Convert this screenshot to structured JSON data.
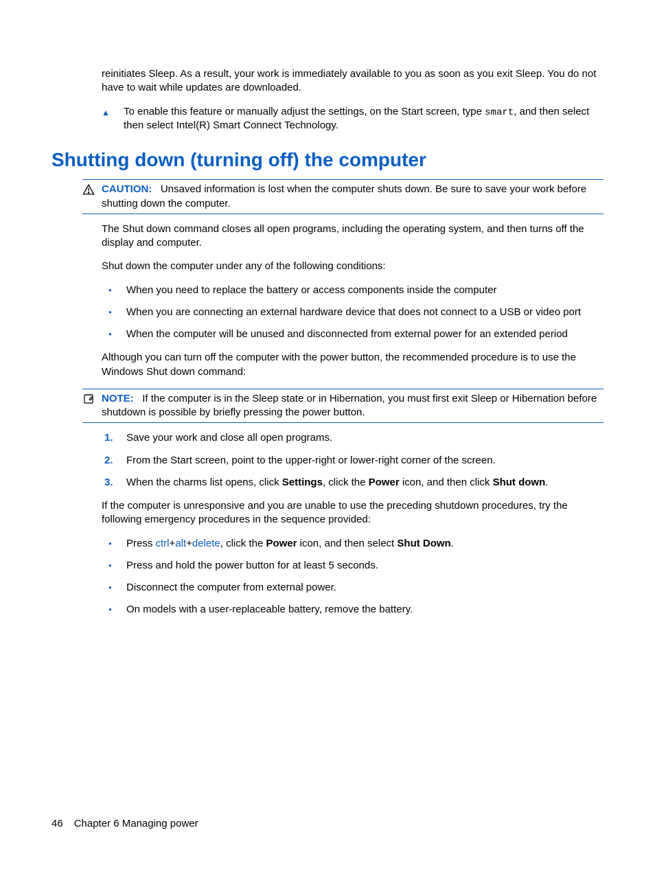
{
  "intro": {
    "p1": "reinitiates Sleep. As a result, your work is immediately available to you as soon as you exit Sleep. You do not have to wait while updates are downloaded.",
    "step_pre": "To enable this feature or manually adjust the settings, on the Start screen, type ",
    "step_code": "smart",
    "step_post": ", and then select then select Intel(R) Smart Connect Technology."
  },
  "heading": "Shutting down (turning off) the computer",
  "caution": {
    "label": "CAUTION:",
    "text": "Unsaved information is lost when the computer shuts down. Be sure to save your work before shutting down the computer."
  },
  "body": {
    "p1": "The Shut down command closes all open programs, including the operating system, and then turns off the display and computer.",
    "p2": "Shut down the computer under any of the following conditions:",
    "conditions": [
      "When you need to replace the battery or access components inside the computer",
      "When you are connecting an external hardware device that does not connect to a USB or video port",
      "When the computer will be unused and disconnected from external power for an extended period"
    ],
    "p3": "Although you can turn off the computer with the power button, the recommended procedure is to use the Windows Shut down command:"
  },
  "note": {
    "label": "NOTE:",
    "text": "If the computer is in the Sleep state or in Hibernation, you must first exit Sleep or Hibernation before shutdown is possible by briefly pressing the power button."
  },
  "steps": {
    "s1": "Save your work and close all open programs.",
    "s2": "From the Start screen, point to the upper-right or lower-right corner of the screen.",
    "s3_a": "When the charms list opens, click ",
    "s3_b1": "Settings",
    "s3_c": ", click the ",
    "s3_b2": "Power",
    "s3_d": " icon, and then click ",
    "s3_b3": "Shut down",
    "s3_e": "."
  },
  "unresponsive": {
    "intro": "If the computer is unresponsive and you are unable to use the preceding shutdown procedures, try the following emergency procedures in the sequence provided:",
    "e1_a": "Press ",
    "e1_k1": "ctrl",
    "e1_k2": "alt",
    "e1_k3": "delete",
    "e1_b": ", click the ",
    "e1_bold": "Power",
    "e1_c": " icon, and then select ",
    "e1_bold2": "Shut Down",
    "e1_d": ".",
    "e2": "Press and hold the power button for at least 5 seconds.",
    "e3": "Disconnect the computer from external power.",
    "e4": "On models with a user-replaceable battery, remove the battery."
  },
  "footer": {
    "page": "46",
    "chapter": "Chapter 6   Managing power"
  }
}
